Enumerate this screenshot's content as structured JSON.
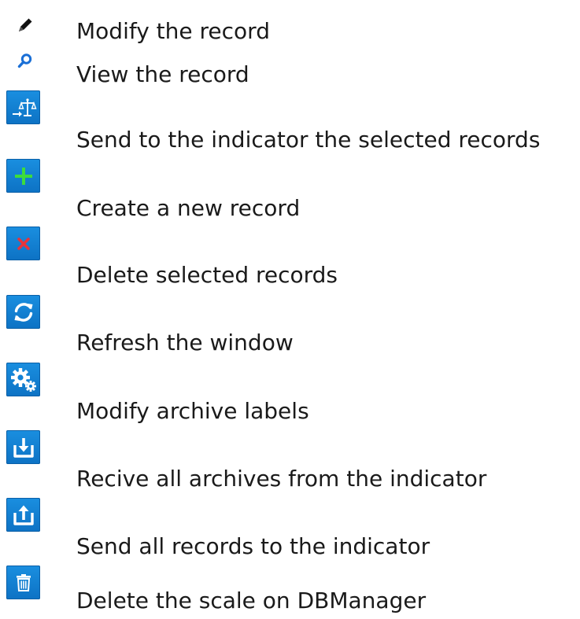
{
  "legend": [
    {
      "icon": "pencil-icon",
      "label": "Modify the record"
    },
    {
      "icon": "magnifier-icon",
      "label": "View the record"
    },
    {
      "icon": "send-to-scale-icon",
      "label": "Send to the indicator the selected records"
    },
    {
      "icon": "plus-icon",
      "label": "Create a new record"
    },
    {
      "icon": "x-icon",
      "label": "Delete selected records"
    },
    {
      "icon": "refresh-icon",
      "label": "Refresh the window"
    },
    {
      "icon": "gears-icon",
      "label": "Modify archive labels"
    },
    {
      "icon": "download-icon",
      "label": "Recive all archives from the indicator"
    },
    {
      "icon": "upload-icon",
      "label": "Send all records to the indicator"
    },
    {
      "icon": "trash-icon",
      "label": "Delete the scale on DBManager"
    }
  ],
  "colors": {
    "button_blue": "#1181d6",
    "plus_green": "#3ddc3d",
    "x_red": "#e8333a",
    "magnifier_blue": "#1a6fd6",
    "icon_white": "#ffffff"
  }
}
